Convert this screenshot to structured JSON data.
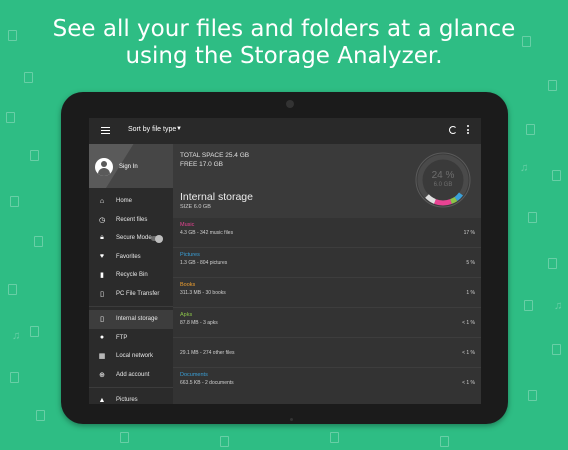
{
  "headline": {
    "line1": "See all your files and folders at a glance",
    "line2": "using the Storage Analyzer."
  },
  "colors": {
    "background": "#2ebd84",
    "music": "#e84393",
    "pictures": "#3aa0d8",
    "books": "#f0a030",
    "apks": "#8bc34a",
    "documents": "#3aa0d8",
    "other": "#e0e0e0"
  },
  "toolbar": {
    "menu_icon": "hamburger-icon",
    "sort_label": "Sort by file type",
    "refresh_icon": "refresh-icon",
    "more_icon": "more-vert-icon"
  },
  "sidebar": {
    "signin_label": "Sign In",
    "items": [
      {
        "label": "Home",
        "icon": "home-icon"
      },
      {
        "label": "Recent files",
        "icon": "history-icon"
      },
      {
        "label": "Secure Mode",
        "icon": "lock-icon"
      },
      {
        "label": "Favorites",
        "icon": "heart-icon"
      },
      {
        "label": "Recycle Bin",
        "icon": "trash-icon"
      },
      {
        "label": "PC File Transfer",
        "icon": "transfer-icon"
      }
    ],
    "locations": [
      {
        "label": "Internal storage",
        "icon": "phone-icon"
      },
      {
        "label": "FTP",
        "icon": "globe-icon"
      },
      {
        "label": "Local network",
        "icon": "network-icon"
      },
      {
        "label": "Add account",
        "icon": "add-icon"
      }
    ],
    "libraries": [
      {
        "label": "Pictures",
        "icon": "image-icon"
      }
    ]
  },
  "summary": {
    "total": "TOTAL SPACE 25.4 GB",
    "free": "FREE 17.0 GB",
    "title": "Internal storage",
    "size": "SIZE 6.0 GB",
    "ring_pct": "24 %",
    "ring_sub": "6.0 GB",
    "used_fraction": 0.24
  },
  "rows": [
    {
      "name": "Music",
      "detail": "4.3 GB - 342 music files",
      "pct": "17 %"
    },
    {
      "name": "Pictures",
      "detail": "1.3 GB - 804 pictures",
      "pct": "5 %"
    },
    {
      "name": "Books",
      "detail": "311.3 MB - 30 books",
      "pct": "1 %"
    },
    {
      "name": "Apks",
      "detail": "87.8 MB - 3 apks",
      "pct": "< 1 %"
    },
    {
      "name": "",
      "detail": "29.1 MB - 274 other files",
      "pct": "< 1 %"
    },
    {
      "name": "Documents",
      "detail": "663.5 KB - 2 documents",
      "pct": "< 1 %"
    }
  ]
}
